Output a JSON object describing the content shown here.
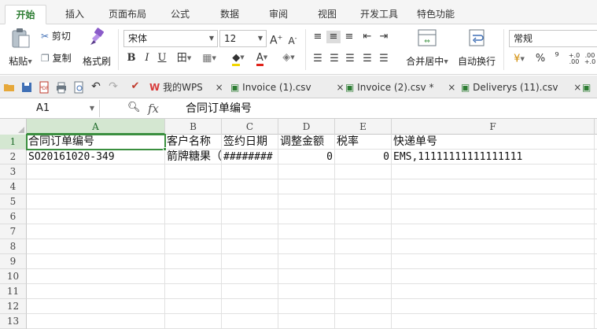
{
  "ribbon_tabs": [
    "开始",
    "插入",
    "页面布局",
    "公式",
    "数据",
    "审阅",
    "视图",
    "开发工具",
    "特色功能"
  ],
  "ribbon": {
    "paste": "粘贴",
    "cut": "剪切",
    "copy": "复制",
    "format_painter": "格式刷",
    "font_name": "宋体",
    "font_size": "12",
    "merge_center": "合并居中",
    "wrap_text": "自动换行",
    "number_format": "常规",
    "percent": "%",
    "comma": "⁹",
    "inc_decimal": "+.0\n.00",
    "dec_decimal": ".00\n+.0"
  },
  "doc_tabs": [
    {
      "label": "我的WPS"
    },
    {
      "label": "Invoice (1).csv"
    },
    {
      "label": "Invoice (2).csv *"
    },
    {
      "label": "Deliverys (11).csv"
    }
  ],
  "formula_bar": {
    "name_box": "A1",
    "fx": "fx",
    "content": "合同订单编号"
  },
  "columns": [
    "A",
    "B",
    "C",
    "D",
    "E",
    "F"
  ],
  "rows": [
    "1",
    "2",
    "3",
    "4",
    "5",
    "6",
    "7",
    "8",
    "9",
    "10",
    "11",
    "12",
    "13"
  ],
  "cells": {
    "A1": "合同订单编号",
    "B1": "客户名称",
    "C1": "签约日期",
    "D1": "调整金额",
    "E1": "税率",
    "F1": "快递单号",
    "A2": "SO20161020-349",
    "B2": "箭牌糖果（",
    "C2": "########",
    "D2": "0",
    "E2": "0",
    "F2": "EMS,11111111111111111"
  },
  "colors": {
    "accent": "#2d7d33",
    "selection": "#3a8f3f",
    "header_selected": "#d4e7d1"
  }
}
